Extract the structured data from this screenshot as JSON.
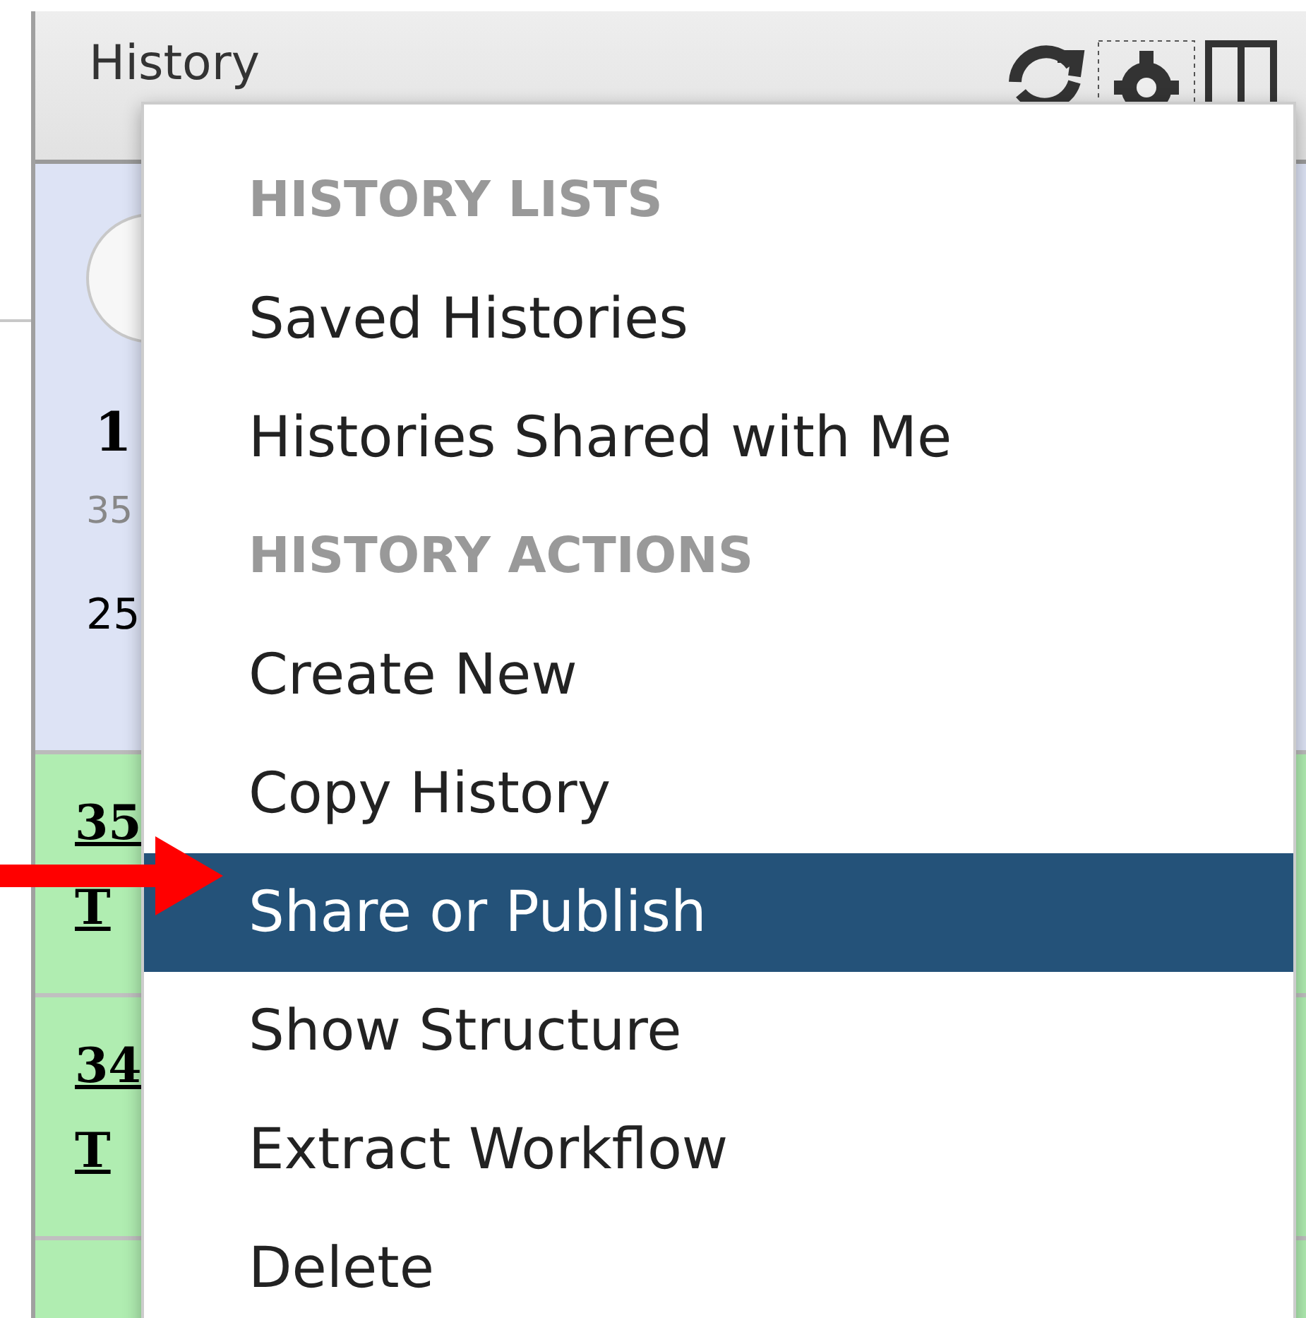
{
  "panel": {
    "title": "History"
  },
  "current_history": {
    "name": "1",
    "size": "35",
    "count": "25"
  },
  "datasets": [
    {
      "number": "35",
      "name": "T"
    },
    {
      "number": "34",
      "name": "T"
    }
  ],
  "menu": {
    "items": [
      {
        "kind": "header",
        "label": "HISTORY LISTS"
      },
      {
        "kind": "item",
        "label": "Saved Histories",
        "selected": false
      },
      {
        "kind": "item",
        "label": "Histories Shared with Me",
        "selected": false
      },
      {
        "kind": "header",
        "label": "HISTORY ACTIONS"
      },
      {
        "kind": "item",
        "label": "Create New",
        "selected": false
      },
      {
        "kind": "item",
        "label": "Copy History",
        "selected": false
      },
      {
        "kind": "item",
        "label": "Share or Publish",
        "selected": true
      },
      {
        "kind": "item",
        "label": "Show Structure",
        "selected": false
      },
      {
        "kind": "item",
        "label": "Extract Workflow",
        "selected": false
      },
      {
        "kind": "item",
        "label": "Delete",
        "selected": false
      }
    ]
  }
}
